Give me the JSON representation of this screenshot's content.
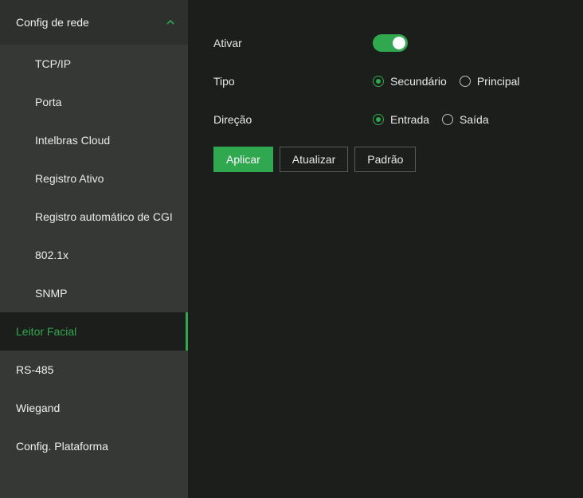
{
  "sidebar": {
    "group": {
      "label": "Config de rede",
      "expanded": true,
      "icon": "chevron-up-icon"
    },
    "subitems": [
      "TCP/IP",
      "Porta",
      "Intelbras Cloud",
      "Registro Ativo",
      "Registro automático de CGI",
      "802.1x",
      "SNMP"
    ],
    "items": [
      {
        "label": "Leitor Facial",
        "active": true
      },
      {
        "label": "RS-485",
        "active": false
      },
      {
        "label": "Wiegand",
        "active": false
      },
      {
        "label": "Config. Plataforma",
        "active": false
      }
    ]
  },
  "form": {
    "ativar": {
      "label": "Ativar",
      "enabled": true
    },
    "tipo": {
      "label": "Tipo",
      "options": [
        "Secundário",
        "Principal"
      ],
      "selected": "Secundário"
    },
    "direcao": {
      "label": "Direção",
      "options": [
        "Entrada",
        "Saída"
      ],
      "selected": "Entrada"
    }
  },
  "buttons": {
    "apply": "Aplicar",
    "refresh": "Atualizar",
    "default": "Padrão"
  },
  "colors": {
    "accent": "#2fa84f",
    "sidebar_bg": "#363836",
    "content_bg": "#1c1e1b"
  }
}
